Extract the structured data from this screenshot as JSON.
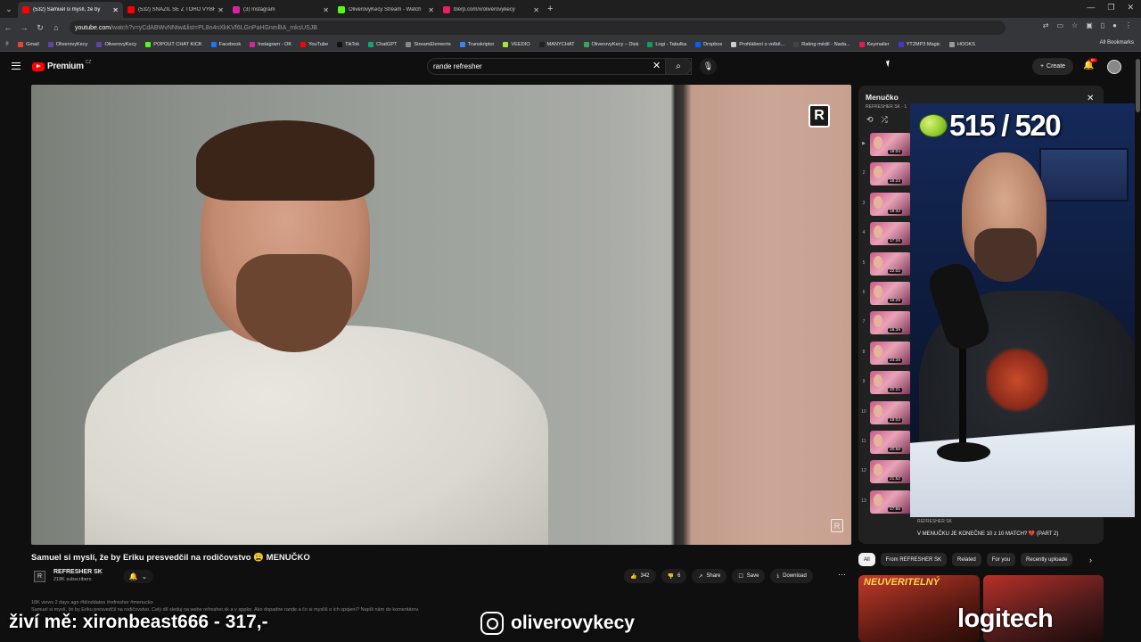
{
  "browser": {
    "tabs": [
      {
        "label": "(532) Samuel si myslí, že by",
        "color": "#ff0000",
        "active": true
      },
      {
        "label": "(532) SNAŽIL SE Z TOHO VYBR",
        "color": "#ff0000",
        "active": false
      },
      {
        "label": "(3) Instagram",
        "color": "#d6249f",
        "active": false
      },
      {
        "label": "OliverovyKecy Stream - Watch",
        "color": "#53fc18",
        "active": false
      },
      {
        "label": "blerp.com/x/oliverovykecy",
        "color": "#e91e63",
        "active": false
      }
    ],
    "url_domain": "youtube.com",
    "url_rest": "/watch?v=yCdABWvNNtw&list=PL8n4nXkKVf6LGnPaHGnmllIA_mksUSJB",
    "bookmarks": [
      {
        "label": "Gmail",
        "color": "#ea4335"
      },
      {
        "label": "OliverovyKecy",
        "color": "#6441a5"
      },
      {
        "label": "OliverovyKecy",
        "color": "#6441a5"
      },
      {
        "label": "POPOUT CHAT KICK",
        "color": "#53fc18"
      },
      {
        "label": "Facebook",
        "color": "#1877f2"
      },
      {
        "label": "Instagram - OK",
        "color": "#d6249f"
      },
      {
        "label": "YouTube",
        "color": "#ff0000"
      },
      {
        "label": "TikTok",
        "color": "#111111"
      },
      {
        "label": "ChatGPT",
        "color": "#10a37f"
      },
      {
        "label": "StreamElements",
        "color": "#888888"
      },
      {
        "label": "Transkriptor",
        "color": "#3b82f6"
      },
      {
        "label": "VEEDIO",
        "color": "#a3e635"
      },
      {
        "label": "MANYCHAT",
        "color": "#222222"
      },
      {
        "label": "OliverovyKecy – Disk",
        "color": "#34a853"
      },
      {
        "label": "Logi - Tabulka",
        "color": "#0f9d58"
      },
      {
        "label": "Dropbox",
        "color": "#0061ff"
      },
      {
        "label": "Prohlášení o volbě...",
        "color": "#cccccc"
      },
      {
        "label": "Rating médií - Nada...",
        "color": "#444444"
      },
      {
        "label": "Keymailer",
        "color": "#e11d48"
      },
      {
        "label": "YT2MP3 Magic",
        "color": "#4338ca"
      },
      {
        "label": "HOOKS",
        "color": "#999999"
      }
    ],
    "all_bookmarks": "All Bookmarks"
  },
  "youtube": {
    "logo_text": "Premium",
    "region": "CZ",
    "search_value": "rande refresher",
    "create_label": "Create",
    "notif_count": "9+"
  },
  "video": {
    "title": "Samuel si myslí, že by Eriku presvedčil na rodičovstvo 😩 MENUČKO",
    "channel": "REFRESHER SK",
    "subscribers": "218K subscribers",
    "likes": "342",
    "dislikes": "6",
    "share": "Share",
    "save": "Save",
    "download": "Download",
    "description": "18K views  2 days ago  #blinddates #refresher #menucko\nSamuel si myslí, že by Eriku presvedčil na rodičovstvo. Celý díl sleduj na webe refresher.sk a v appke. Ako dopadne rande a čo si myslíš o ich spojení? Napíš nám do komentárov."
  },
  "playlist": {
    "title": "Menučko",
    "subtitle": "REFRESHER SK - 1",
    "items": [
      {
        "n": "",
        "dur": "19:04"
      },
      {
        "n": "2",
        "dur": "18:23"
      },
      {
        "n": "3",
        "dur": "19:32"
      },
      {
        "n": "4",
        "dur": "17:26"
      },
      {
        "n": "5",
        "dur": "22:02"
      },
      {
        "n": "6",
        "dur": "16:29"
      },
      {
        "n": "7",
        "dur": "16:39"
      },
      {
        "n": "8",
        "dur": "24:26"
      },
      {
        "n": "9",
        "dur": "20:21"
      },
      {
        "n": "10",
        "dur": "19:03"
      },
      {
        "n": "11",
        "dur": "20:58"
      },
      {
        "n": "12",
        "dur": "21:52"
      },
      {
        "n": "13",
        "dur": "17:56"
      }
    ],
    "bottom_channel": "REFRESHER SK",
    "bottom_title": "V MENUČKU JE KONEČNE 10 z 10 MATCH? 💔 (PART 2)"
  },
  "chips": [
    "All",
    "From REFRESHER SK",
    "Related",
    "For you",
    "Recently uploade"
  ],
  "rec1_text": "NEUVERITELNÝ",
  "stream": {
    "score": "515 / 520",
    "overlay_left": "živí mě: xironbeast666 - 317,-",
    "overlay_ig": "oliverovykecy",
    "overlay_brand": "logitech"
  }
}
